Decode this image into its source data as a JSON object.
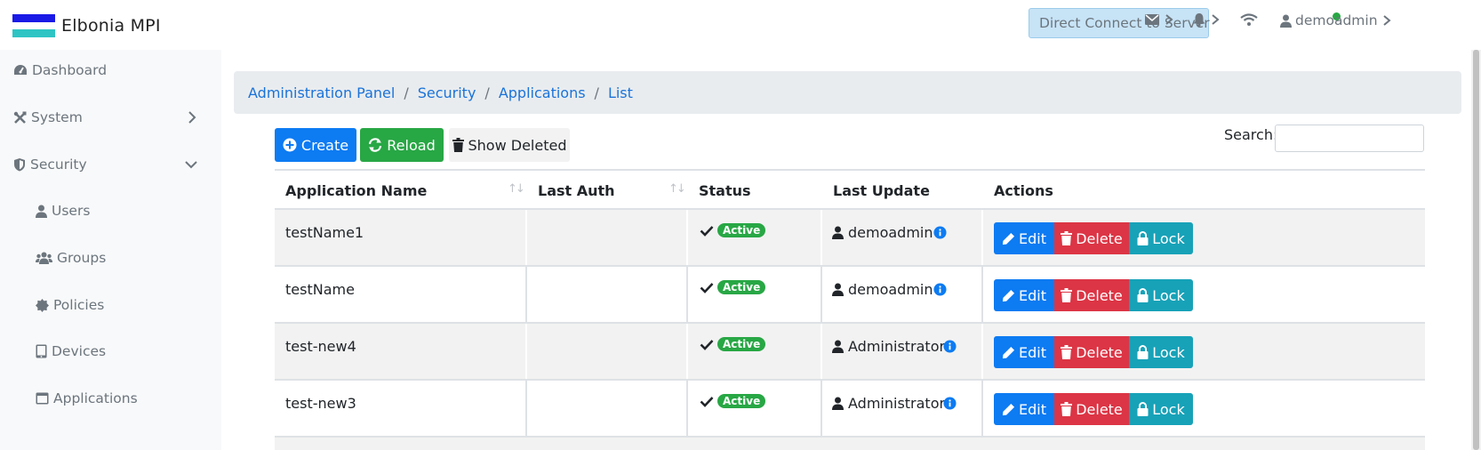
{
  "brand": {
    "title": "Elbonia MPI"
  },
  "topbar": {
    "direct_connect_label": "Direct Connect to Server",
    "user_name": "demoadmin"
  },
  "sidebar": {
    "items": [
      {
        "label": "Dashboard",
        "icon": "dashboard-icon"
      },
      {
        "label": "System",
        "icon": "tools-icon"
      },
      {
        "label": "Security",
        "icon": "shield-icon"
      },
      {
        "label": "Users",
        "icon": "user-icon"
      },
      {
        "label": "Groups",
        "icon": "users-icon"
      },
      {
        "label": "Policies",
        "icon": "certificate-icon"
      },
      {
        "label": "Devices",
        "icon": "tablet-icon"
      },
      {
        "label": "Applications",
        "icon": "window-icon"
      }
    ]
  },
  "breadcrumb": [
    "Administration Panel",
    "Security",
    "Applications",
    "List"
  ],
  "toolbar": {
    "create_label": "Create",
    "reload_label": "Reload",
    "show_deleted_label": "Show Deleted",
    "search_label": "Search:",
    "search_value": ""
  },
  "table": {
    "columns": [
      "Application Name",
      "Last Auth",
      "Status",
      "Last Update",
      "Actions"
    ],
    "rows": [
      {
        "name": "testName1",
        "last_auth": "",
        "status": "Active",
        "updated_by": "demoadmin"
      },
      {
        "name": "testName",
        "last_auth": "",
        "status": "Active",
        "updated_by": "demoadmin"
      },
      {
        "name": "test-new4",
        "last_auth": "",
        "status": "Active",
        "updated_by": "Administrator"
      },
      {
        "name": "test-new3",
        "last_auth": "",
        "status": "Active",
        "updated_by": "Administrator"
      }
    ],
    "actions": {
      "edit": "Edit",
      "delete": "Delete",
      "lock": "Lock"
    }
  },
  "colors": {
    "primary": "#0d7bf2",
    "success": "#28a745",
    "danger": "#dc3545",
    "info": "#17a2b8",
    "link": "#1a73d9"
  }
}
